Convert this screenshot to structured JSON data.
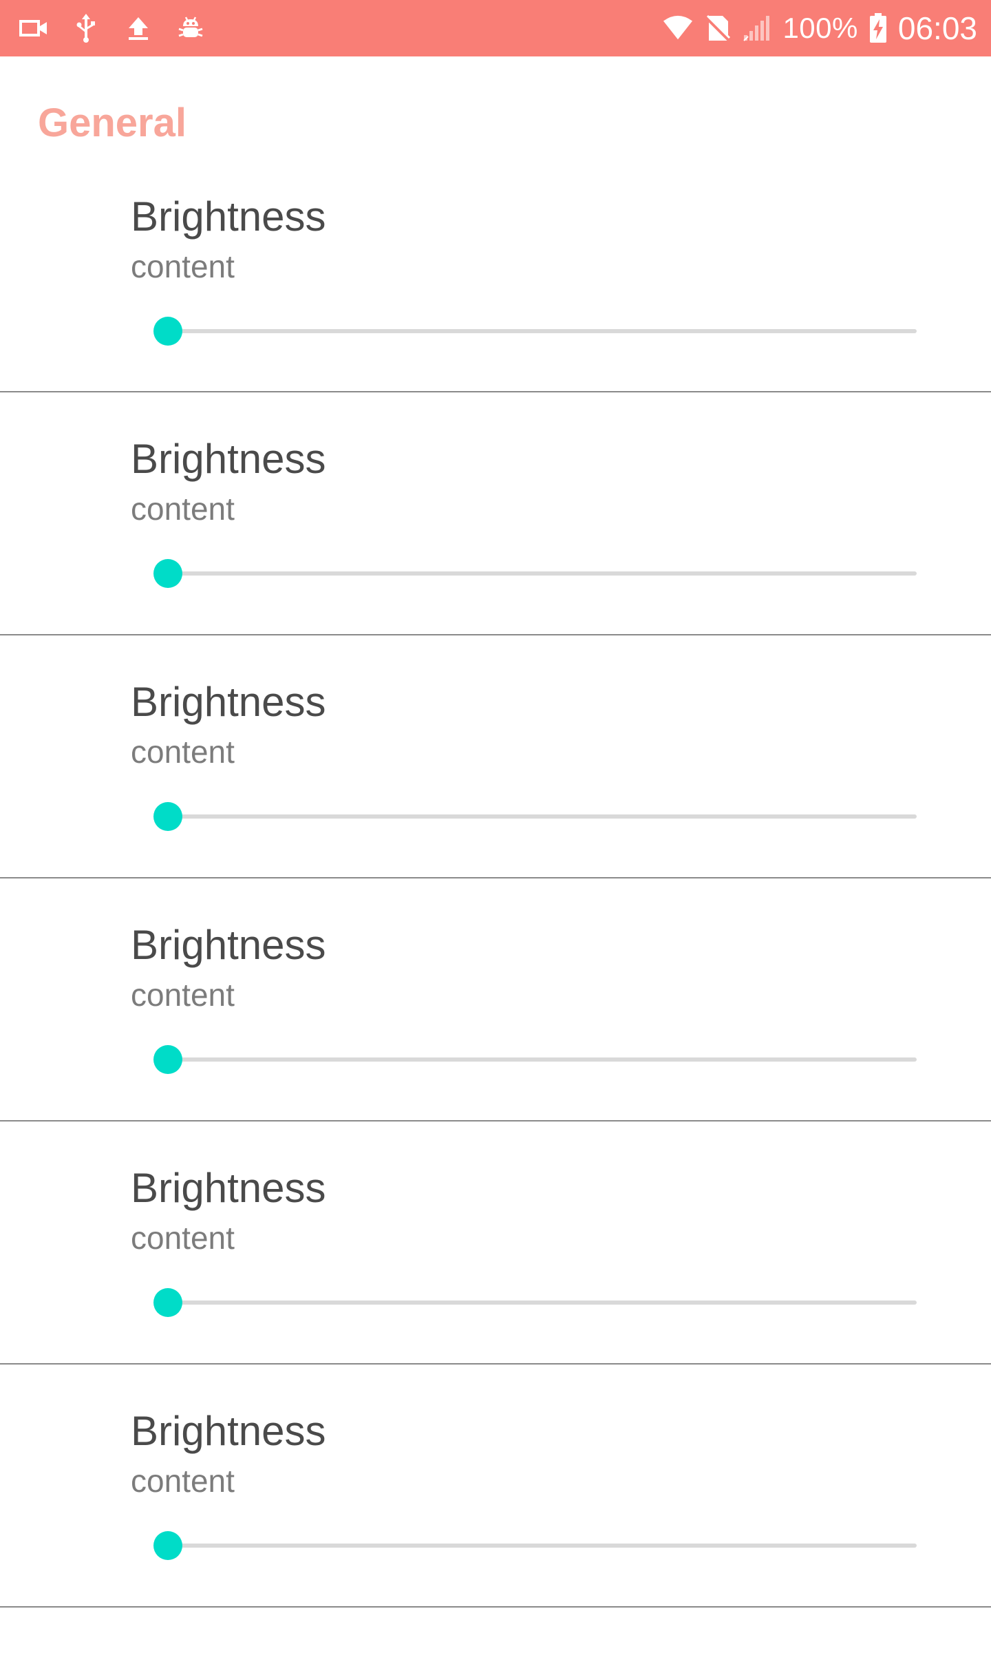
{
  "status_bar": {
    "left_icons": [
      "video-camera-icon",
      "usb-icon",
      "upload-icon",
      "android-debug-icon"
    ],
    "battery_percent": "100%",
    "time": "06:03",
    "color": "#f97e76"
  },
  "section": {
    "title": "General",
    "color": "#f8a69a"
  },
  "accent_color": "#00dcc8",
  "preferences": [
    {
      "title": "Brightness",
      "summary": "content",
      "value_fraction": 0
    },
    {
      "title": "Brightness",
      "summary": "content",
      "value_fraction": 0
    },
    {
      "title": "Brightness",
      "summary": "content",
      "value_fraction": 0
    },
    {
      "title": "Brightness",
      "summary": "content",
      "value_fraction": 0
    },
    {
      "title": "Brightness",
      "summary": "content",
      "value_fraction": 0
    },
    {
      "title": "Brightness",
      "summary": "content",
      "value_fraction": 0
    }
  ]
}
